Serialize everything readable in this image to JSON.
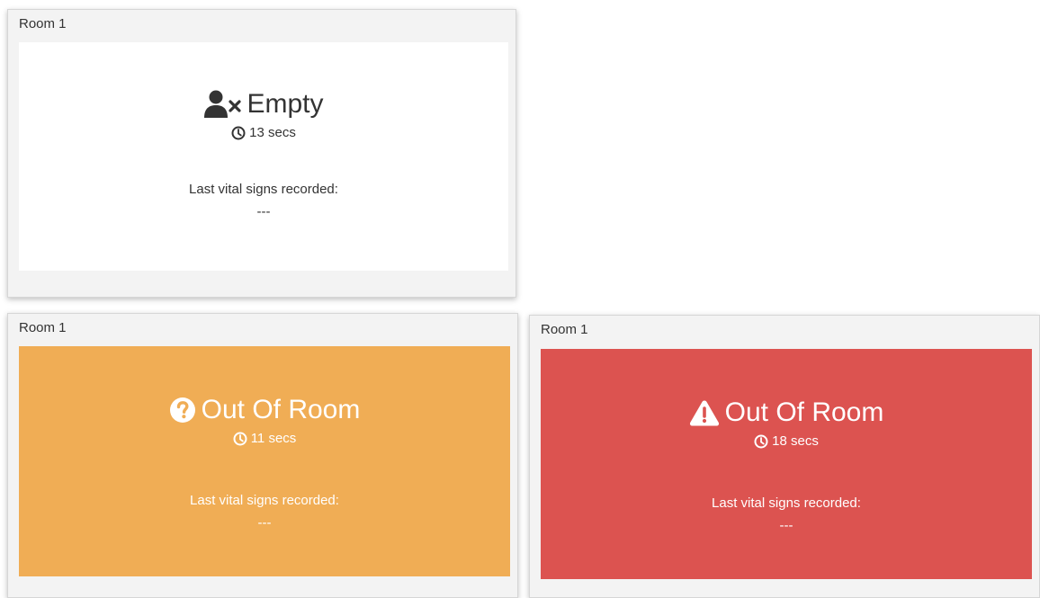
{
  "cards": [
    {
      "title": "Room 1",
      "status": "Empty",
      "status_icon": "user-times-icon",
      "timer": "13 secs",
      "vitals_label": "Last vital signs recorded:",
      "vitals_value": "---",
      "panel_color": "#ffffff",
      "text_color": "#333333"
    },
    {
      "title": "Room 1",
      "status": "Out Of Room",
      "status_icon": "question-circle-icon",
      "timer": "11 secs",
      "vitals_label": "Last vital signs recorded:",
      "vitals_value": "---",
      "panel_color": "#f0ad55",
      "text_color": "#ffffff"
    },
    {
      "title": "Room 1",
      "status": "Out Of Room",
      "status_icon": "warning-triangle-icon",
      "timer": "18 secs",
      "vitals_label": "Last vital signs recorded:",
      "vitals_value": "---",
      "panel_color": "#dc5350",
      "text_color": "#ffffff"
    }
  ]
}
